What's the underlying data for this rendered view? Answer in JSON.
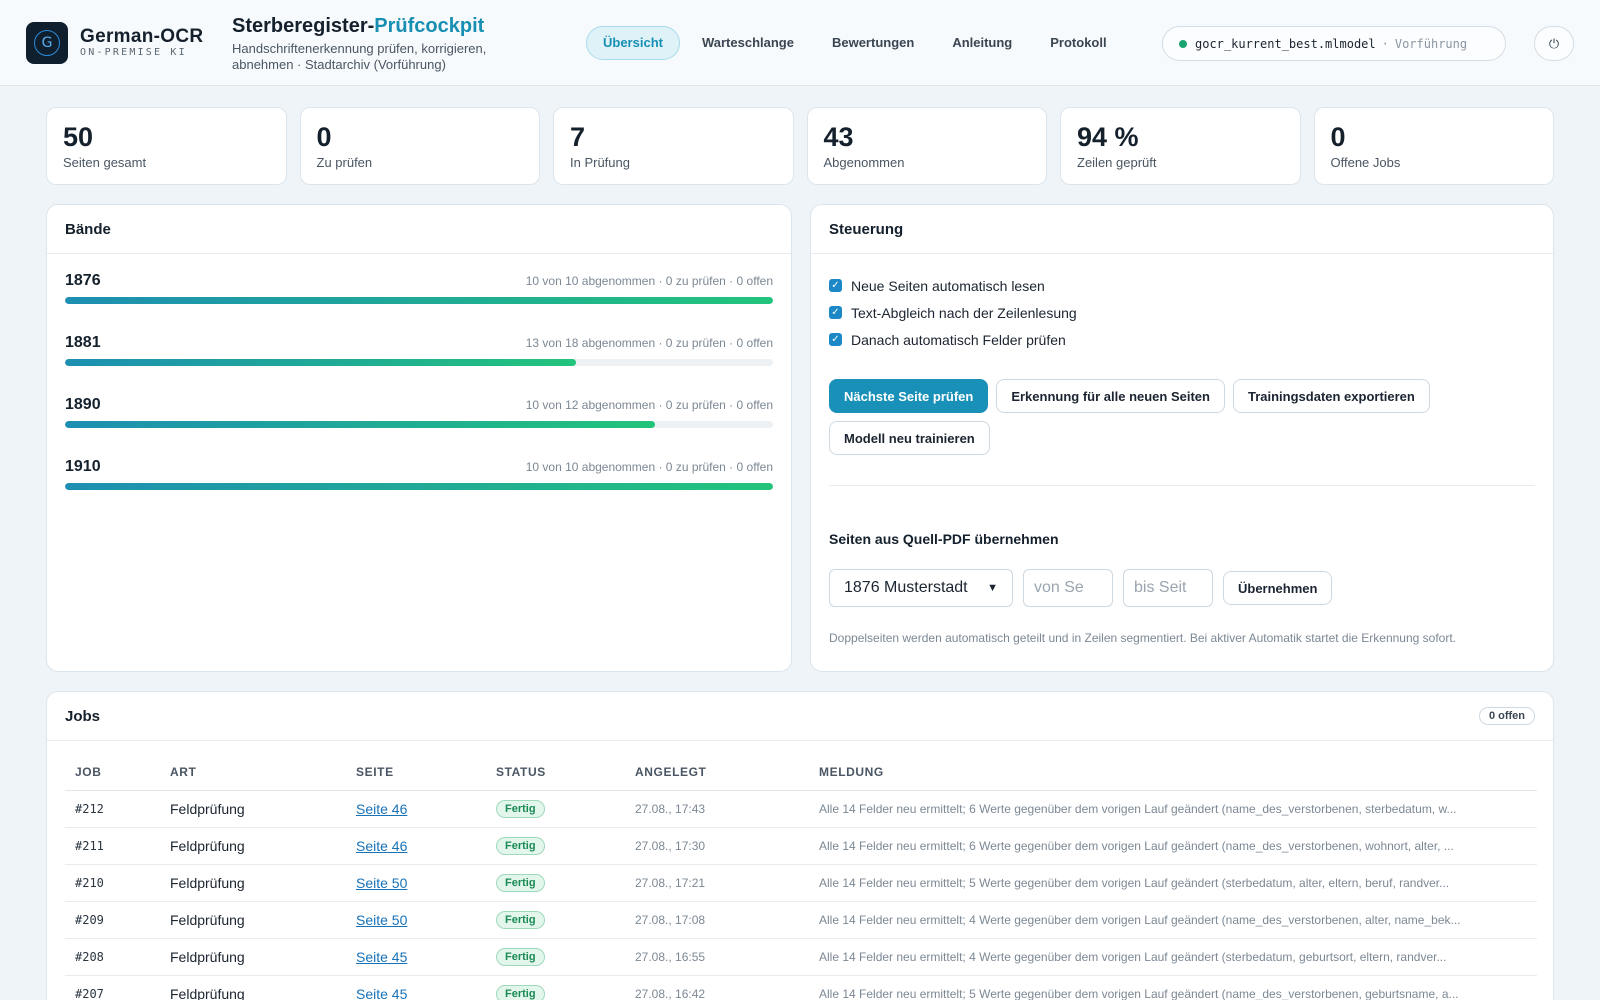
{
  "brand": {
    "logo_letter": "G",
    "name": "German-OCR",
    "subtitle": "ON-PREMISE KI"
  },
  "app": {
    "title_main": "Sterberegister-",
    "title_accent": "Prüfcockpit",
    "description": "Handschriftenerkennung prüfen, korrigieren, abnehmen · Stadtarchiv (Vorführung)"
  },
  "nav": {
    "items": [
      "Übersicht",
      "Warteschlange",
      "Bewertungen",
      "Anleitung",
      "Protokoll"
    ],
    "active_index": 0
  },
  "model": {
    "name": "gocr_kurrent_best.mlmodel",
    "separator": "·",
    "mode": "Vorführung",
    "status_color": "#1aa46f"
  },
  "power_icon": "⏻",
  "stats": [
    {
      "value": "50",
      "label": "Seiten gesamt"
    },
    {
      "value": "0",
      "label": "Zu prüfen"
    },
    {
      "value": "7",
      "label": "In Prüfung"
    },
    {
      "value": "43",
      "label": "Abgenommen"
    },
    {
      "value": "94 %",
      "label": "Zeilen geprüft"
    },
    {
      "value": "0",
      "label": "Offene Jobs"
    }
  ],
  "volumes": {
    "title": "Bände",
    "items": [
      {
        "year": "1876",
        "meta": "10 von 10 abgenommen · 0 zu prüfen · 0 offen",
        "progress": 1.0
      },
      {
        "year": "1881",
        "meta": "13 von 18 abgenommen · 0 zu prüfen · 0 offen",
        "progress": 0.7222
      },
      {
        "year": "1890",
        "meta": "10 von 12 abgenommen · 0 zu prüfen · 0 offen",
        "progress": 0.8333
      },
      {
        "year": "1910",
        "meta": "10 von 10 abgenommen · 0 zu prüfen · 0 offen",
        "progress": 1.0
      }
    ]
  },
  "control": {
    "title": "Steuerung",
    "checkboxes": [
      {
        "label": "Neue Seiten automatisch lesen",
        "checked": true
      },
      {
        "label": "Text-Abgleich nach der Zeilenlesung",
        "checked": true
      },
      {
        "label": "Danach automatisch Felder prüfen",
        "checked": true
      }
    ],
    "buttons": {
      "next_page": "Nächste Seite prüfen",
      "recognize_all": "Erkennung für alle neuen Seiten",
      "export_training": "Trainingsdaten exportieren",
      "retrain": "Modell neu trainieren"
    },
    "import": {
      "title": "Seiten aus Quell-PDF übernehmen",
      "selected_source": "1876 Musterstadt",
      "from_placeholder": "von Se",
      "to_placeholder": "bis Seit",
      "apply_label": "Übernehmen",
      "note": "Doppelseiten werden automatisch geteilt und in Zeilen segmentiert. Bei aktiver Automatik startet die Erkennung sofort."
    }
  },
  "jobs": {
    "title": "Jobs",
    "open_badge": "0 offen",
    "columns": [
      "JOB",
      "ART",
      "SEITE",
      "STATUS",
      "ANGELEGT",
      "MELDUNG"
    ],
    "rows": [
      {
        "id": "#212",
        "type": "Feldprüfung",
        "page": "Seite 46",
        "status": "Fertig",
        "created": "27.08., 17:43",
        "message": "Alle 14 Felder neu ermittelt; 6 Werte gegenüber dem vorigen Lauf geändert (name_des_verstorbenen, sterbedatum, w..."
      },
      {
        "id": "#211",
        "type": "Feldprüfung",
        "page": "Seite 46",
        "status": "Fertig",
        "created": "27.08., 17:30",
        "message": "Alle 14 Felder neu ermittelt; 6 Werte gegenüber dem vorigen Lauf geändert (name_des_verstorbenen, wohnort, alter, ..."
      },
      {
        "id": "#210",
        "type": "Feldprüfung",
        "page": "Seite 50",
        "status": "Fertig",
        "created": "27.08., 17:21",
        "message": "Alle 14 Felder neu ermittelt; 5 Werte gegenüber dem vorigen Lauf geändert (sterbedatum, alter, eltern, beruf, randver..."
      },
      {
        "id": "#209",
        "type": "Feldprüfung",
        "page": "Seite 50",
        "status": "Fertig",
        "created": "27.08., 17:08",
        "message": "Alle 14 Felder neu ermittelt; 4 Werte gegenüber dem vorigen Lauf geändert (name_des_verstorbenen, alter, name_bek..."
      },
      {
        "id": "#208",
        "type": "Feldprüfung",
        "page": "Seite 45",
        "status": "Fertig",
        "created": "27.08., 16:55",
        "message": "Alle 14 Felder neu ermittelt; 4 Werte gegenüber dem vorigen Lauf geändert (sterbedatum, geburtsort, eltern, randver..."
      },
      {
        "id": "#207",
        "type": "Feldprüfung",
        "page": "Seite 45",
        "status": "Fertig",
        "created": "27.08., 16:42",
        "message": "Alle 14 Felder neu ermittelt; 5 Werte gegenüber dem vorigen Lauf geändert (name_des_verstorbenen, geburtsname, a..."
      }
    ]
  }
}
